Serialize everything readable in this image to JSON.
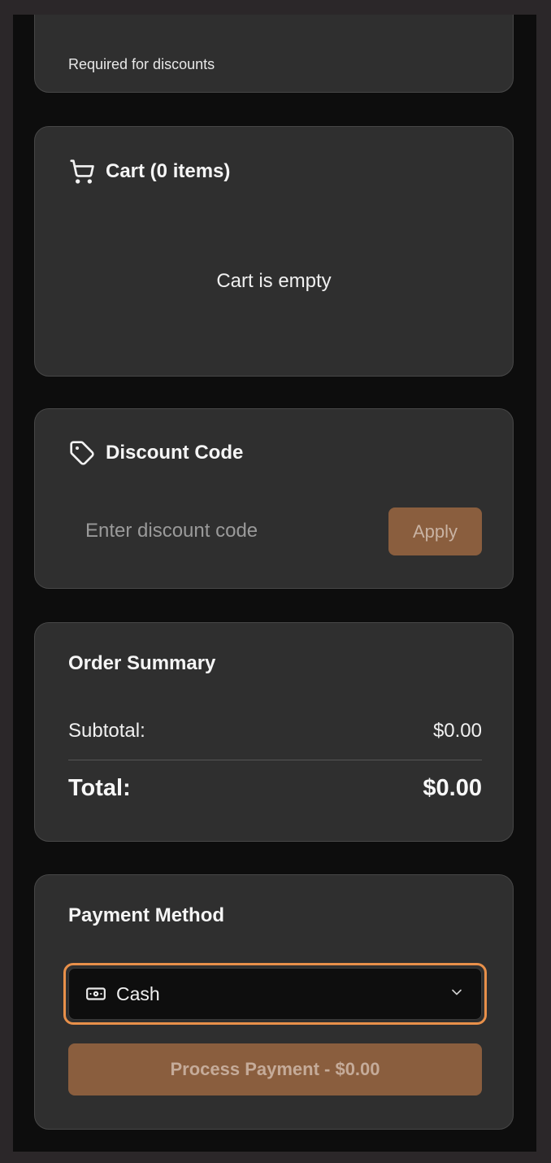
{
  "customer": {
    "hint": "Required for discounts"
  },
  "cart": {
    "title": "Cart (0 items)",
    "empty_message": "Cart is empty",
    "icon": "cart-icon"
  },
  "discount": {
    "title": "Discount Code",
    "icon": "tag-icon",
    "input_value": "",
    "input_placeholder": "Enter discount code",
    "apply_label": "Apply"
  },
  "summary": {
    "title": "Order Summary",
    "subtotal_label": "Subtotal:",
    "subtotal_value": "$0.00",
    "total_label": "Total:",
    "total_value": "$0.00"
  },
  "payment": {
    "title": "Payment Method",
    "selected_method": "Cash",
    "method_icon": "cash-icon",
    "process_label": "Process Payment - $0.00"
  },
  "colors": {
    "accent": "#e8904a",
    "button_bg": "#8a5e3e",
    "card_bg": "#2f2f2f",
    "page_bg": "#0d0d0d"
  }
}
